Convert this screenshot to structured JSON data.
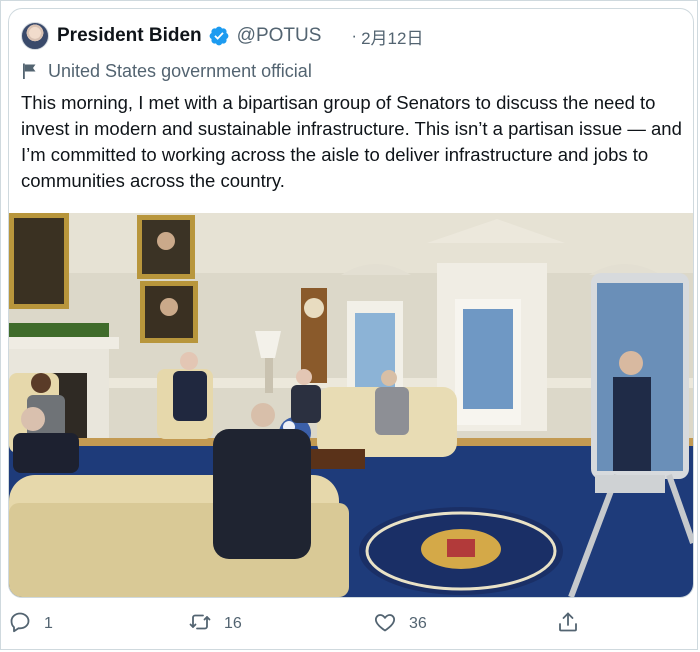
{
  "tweet": {
    "display_name": "President Biden",
    "handle": "@POTUS",
    "separator": "·",
    "timestamp": "2月12日",
    "account_label": "United States government official",
    "text": "This morning, I met with a bipartisan group of Senators to discuss the need to invest in modern and sustainable infrastructure. This isn’t a partisan issue — and I’m committed to working across the aisle to deliver infrastructure and jobs to communities across the country.",
    "verified": true,
    "verified_color": "#1d9bf0"
  },
  "actions": {
    "reply": {
      "icon": "reply-icon",
      "count": "1"
    },
    "retweet": {
      "icon": "retweet-icon",
      "count": "16"
    },
    "like": {
      "icon": "heart-icon",
      "count": "36"
    },
    "share": {
      "icon": "share-icon"
    }
  },
  "colors": {
    "text_primary": "#0f1419",
    "text_secondary": "#536471",
    "border": "#cfd9de",
    "icon": "#536471"
  }
}
